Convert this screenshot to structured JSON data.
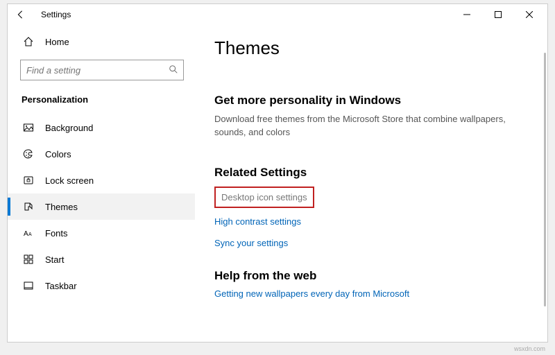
{
  "window": {
    "title": "Settings"
  },
  "sidebar": {
    "home": "Home",
    "search_placeholder": "Find a setting",
    "section": "Personalization",
    "items": [
      {
        "label": "Background"
      },
      {
        "label": "Colors"
      },
      {
        "label": "Lock screen"
      },
      {
        "label": "Themes"
      },
      {
        "label": "Fonts"
      },
      {
        "label": "Start"
      },
      {
        "label": "Taskbar"
      }
    ]
  },
  "content": {
    "title": "Themes",
    "personality_h": "Get more personality in Windows",
    "personality_desc": "Download free themes from the Microsoft Store that combine wallpapers, sounds, and colors",
    "related_h": "Related Settings",
    "link_desktop_icons": "Desktop icon settings",
    "link_high_contrast": "High contrast settings",
    "link_sync": "Sync your settings",
    "help_h": "Help from the web",
    "link_wallpapers": "Getting new wallpapers every day from Microsoft"
  },
  "watermark": "wsxdn.com"
}
